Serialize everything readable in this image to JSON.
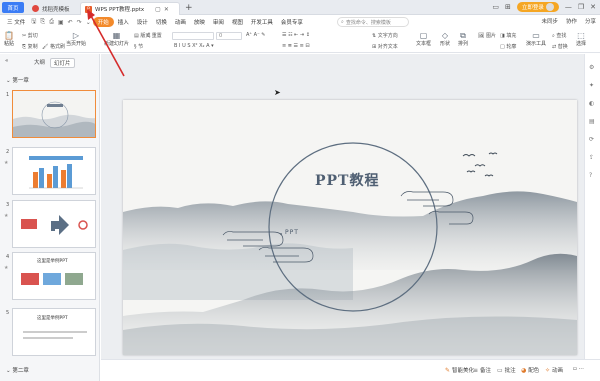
{
  "titlebar": {
    "tabs": [
      {
        "label": "首页"
      },
      {
        "label": "找稻壳模板"
      },
      {
        "label": "WPS PPT教程.pptx"
      }
    ],
    "new_tab": "+",
    "login_label": "立即登录"
  },
  "menubar": {
    "file_label": "三 文件",
    "items": [
      "开始",
      "插入",
      "设计",
      "切换",
      "动画",
      "放映",
      "审阅",
      "视图",
      "开发工具",
      "会员专享"
    ],
    "search_placeholder": "查找命令、搜索模板",
    "right_items": [
      "未同步",
      "协作",
      "分享"
    ]
  },
  "ribbon": {
    "paste": "粘贴",
    "cut": "剪切",
    "copy": "复制",
    "format_painter": "格式刷",
    "play_from_current": "当页开始",
    "new_slide": "新建幻灯片",
    "layout": "版式",
    "section": "节",
    "reset": "重置",
    "font_size": "0",
    "text_align": "文字方向",
    "align_text": "对齐文本",
    "textbox": "文本框",
    "shape": "形状",
    "arrange": "排列",
    "picture": "图片",
    "fill": "填充",
    "outline": "轮廓",
    "presenter_tools": "演示工具",
    "find": "查找",
    "replace": "替换",
    "select": "选择"
  },
  "leftpanel": {
    "view_outline": "大纲",
    "view_slides": "幻灯片",
    "section_1": "第一章",
    "section_2": "第二章",
    "thumbnails": [
      {
        "num": "1",
        "title": ""
      },
      {
        "num": "2",
        "title": ""
      },
      {
        "num": "3",
        "title": ""
      },
      {
        "num": "4",
        "title": "这里是举例PPT"
      },
      {
        "num": "5",
        "title": "这里是举例PPT"
      }
    ]
  },
  "slide": {
    "title": "PPT教程",
    "subtitle": "PPT"
  },
  "statusbar": {
    "items": [
      "智能美化",
      "备注",
      "批注",
      "配色",
      "动画"
    ]
  }
}
